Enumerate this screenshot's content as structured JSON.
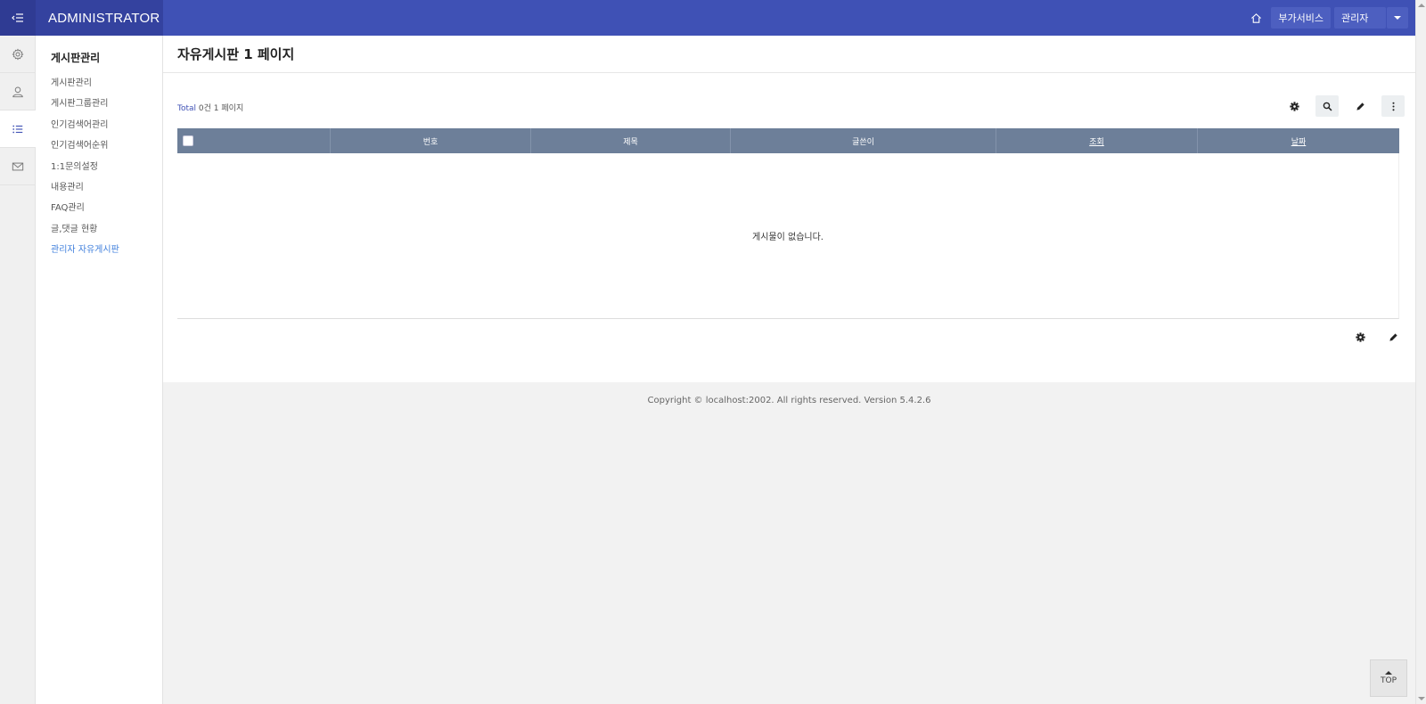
{
  "header": {
    "brand": "ADMINISTRATOR",
    "extra_service": "부가서비스",
    "admin": "관리자"
  },
  "rail": [
    {
      "icon": "gear-icon"
    },
    {
      "icon": "user-icon"
    },
    {
      "icon": "list-icon",
      "active": true
    },
    {
      "icon": "mail-icon"
    }
  ],
  "submenu": {
    "title": "게시판관리",
    "items": [
      {
        "label": "게시판관리"
      },
      {
        "label": "게시판그룹관리"
      },
      {
        "label": "인기검색어관리"
      },
      {
        "label": "인기검색어순위"
      },
      {
        "label": "1:1문의설정"
      },
      {
        "label": "내용관리"
      },
      {
        "label": "FAQ관리"
      },
      {
        "label": "글,댓글 현황"
      },
      {
        "label": "관리자 자유게시판",
        "active": true
      }
    ]
  },
  "page": {
    "title": "자유게시판 1 페이지",
    "total_prefix": "Total",
    "total_count": "0건",
    "page_info": "1 페이지"
  },
  "board": {
    "columns": {
      "num": "번호",
      "subject": "제목",
      "writer": "글쓴이",
      "hit": "조회",
      "date": "날짜"
    },
    "empty": "게시물이 없습니다."
  },
  "footer": {
    "copyright": "Copyright © localhost:2002. All rights reserved. Version 5.4.2.6"
  },
  "top_button": "TOP",
  "colors": {
    "header": "#3f51b5",
    "table_head": "#6d7f99",
    "active_link": "#3f7fdc"
  }
}
